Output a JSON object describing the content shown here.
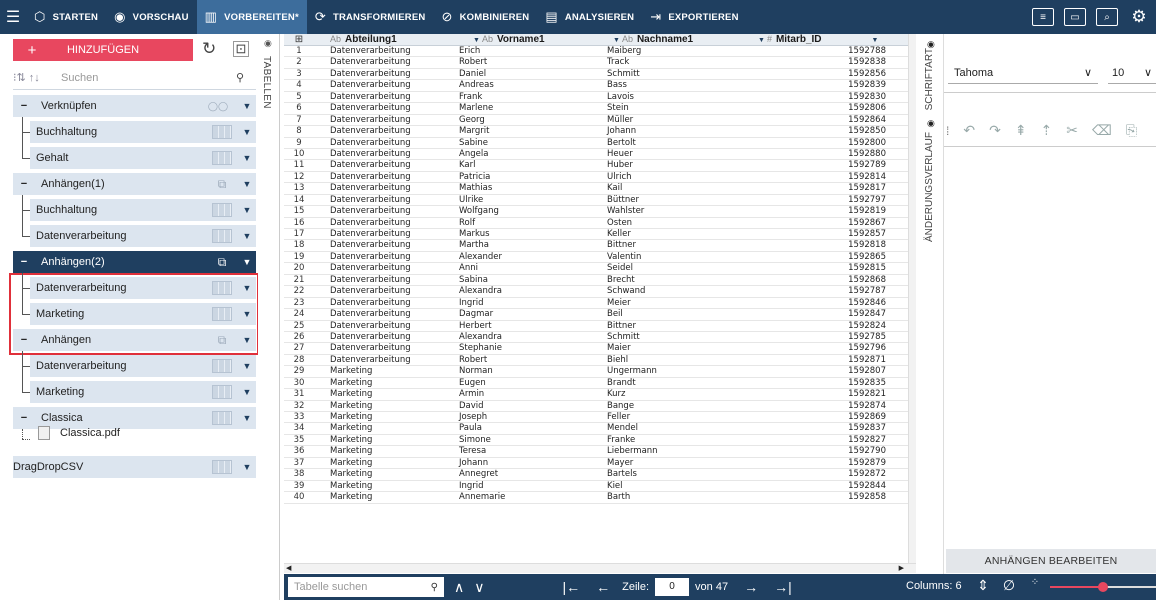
{
  "topbar": {
    "items": [
      {
        "label": "STARTEN",
        "icon": "cube-icon"
      },
      {
        "label": "VORSCHAU",
        "icon": "eye-icon"
      },
      {
        "label": "VORBEREITEN*",
        "icon": "table-icon",
        "active": true
      },
      {
        "label": "TRANSFORMIEREN",
        "icon": "transform-icon"
      },
      {
        "label": "KOMBINIEREN",
        "icon": "combine-icon"
      },
      {
        "label": "ANALYSIEREN",
        "icon": "analyze-icon"
      },
      {
        "label": "EXPORTIEREN",
        "icon": "export-icon"
      }
    ],
    "colors": {
      "bar": "#1f3f60",
      "active": "#3d6d9c"
    }
  },
  "left": {
    "add_label": "HINZUFÜGEN",
    "search_placeholder": "Suchen",
    "tree": [
      {
        "label": "Verknüpfen",
        "type": "group"
      },
      {
        "label": "Buchhaltung",
        "type": "child"
      },
      {
        "label": "Gehalt",
        "type": "child"
      },
      {
        "label": "Anhängen(1)",
        "type": "group"
      },
      {
        "label": "Buchhaltung",
        "type": "child"
      },
      {
        "label": "Datenverarbeitung",
        "type": "child"
      },
      {
        "label": "Anhängen(2)",
        "type": "group",
        "active": true
      },
      {
        "label": "Datenverarbeitung",
        "type": "child"
      },
      {
        "label": "Marketing",
        "type": "child"
      },
      {
        "label": "Anhängen",
        "type": "group"
      },
      {
        "label": "Datenverarbeitung",
        "type": "child"
      },
      {
        "label": "Marketing",
        "type": "child"
      },
      {
        "label": "Classica",
        "type": "group"
      },
      {
        "label": "DragDropCSV",
        "type": "root"
      }
    ],
    "pdf_file": "Classica.pdf"
  },
  "tables_tab_label": "TABELLEN",
  "grid": {
    "columns": [
      {
        "type": "Ab",
        "name": "Abteilung1"
      },
      {
        "type": "Ab",
        "name": "Vorname1"
      },
      {
        "type": "Ab",
        "name": "Nachname1"
      },
      {
        "type": "#",
        "name": "Mitarb_ID"
      }
    ],
    "rows": [
      [
        "1",
        "Datenverarbeitung",
        "Erich",
        "Maiberg",
        "1592788"
      ],
      [
        "2",
        "Datenverarbeitung",
        "Robert",
        "Track",
        "1592838"
      ],
      [
        "3",
        "Datenverarbeitung",
        "Daniel",
        "Schmitt",
        "1592856"
      ],
      [
        "4",
        "Datenverarbeitung",
        "Andreas",
        "Bass",
        "1592839"
      ],
      [
        "5",
        "Datenverarbeitung",
        "Frank",
        "Lavois",
        "1592830"
      ],
      [
        "6",
        "Datenverarbeitung",
        "Marlene",
        "Stein",
        "1592806"
      ],
      [
        "7",
        "Datenverarbeitung",
        "Georg",
        "Müller",
        "1592864"
      ],
      [
        "8",
        "Datenverarbeitung",
        "Margrit",
        "Johann",
        "1592850"
      ],
      [
        "9",
        "Datenverarbeitung",
        "Sabine",
        "Bertolt",
        "1592800"
      ],
      [
        "10",
        "Datenverarbeitung",
        "Angela",
        "Heuer",
        "1592880"
      ],
      [
        "11",
        "Datenverarbeitung",
        "Karl",
        "Huber",
        "1592789"
      ],
      [
        "12",
        "Datenverarbeitung",
        "Patricia",
        "Ulrich",
        "1592814"
      ],
      [
        "13",
        "Datenverarbeitung",
        "Mathias",
        "Kail",
        "1592817"
      ],
      [
        "14",
        "Datenverarbeitung",
        "Ulrike",
        "Büttner",
        "1592797"
      ],
      [
        "15",
        "Datenverarbeitung",
        "Wolfgang",
        "Wahlster",
        "1592819"
      ],
      [
        "16",
        "Datenverarbeitung",
        "Rolf",
        "Osten",
        "1592867"
      ],
      [
        "17",
        "Datenverarbeitung",
        "Markus",
        "Keller",
        "1592857"
      ],
      [
        "18",
        "Datenverarbeitung",
        "Martha",
        "Bittner",
        "1592818"
      ],
      [
        "19",
        "Datenverarbeitung",
        "Alexander",
        "Valentin",
        "1592865"
      ],
      [
        "20",
        "Datenverarbeitung",
        "Anni",
        "Seidel",
        "1592815"
      ],
      [
        "21",
        "Datenverarbeitung",
        "Sabina",
        "Brecht",
        "1592868"
      ],
      [
        "22",
        "Datenverarbeitung",
        "Alexandra",
        "Schwand",
        "1592787"
      ],
      [
        "23",
        "Datenverarbeitung",
        "Ingrid",
        "Meier",
        "1592846"
      ],
      [
        "24",
        "Datenverarbeitung",
        "Dagmar",
        "Beil",
        "1592847"
      ],
      [
        "25",
        "Datenverarbeitung",
        "Herbert",
        "Bittner",
        "1592824"
      ],
      [
        "26",
        "Datenverarbeitung",
        "Alexandra",
        "Schmitt",
        "1592785"
      ],
      [
        "27",
        "Datenverarbeitung",
        "Stephanie",
        "Maier",
        "1592796"
      ],
      [
        "28",
        "Datenverarbeitung",
        "Robert",
        "Biehl",
        "1592871"
      ],
      [
        "29",
        "Marketing",
        "Norman",
        "Ungermann",
        "1592807"
      ],
      [
        "30",
        "Marketing",
        "Eugen",
        "Brandt",
        "1592835"
      ],
      [
        "31",
        "Marketing",
        "Armin",
        "Kurz",
        "1592821"
      ],
      [
        "32",
        "Marketing",
        "David",
        "Bange",
        "1592874"
      ],
      [
        "33",
        "Marketing",
        "Joseph",
        "Feller",
        "1592869"
      ],
      [
        "34",
        "Marketing",
        "Paula",
        "Mendel",
        "1592837"
      ],
      [
        "35",
        "Marketing",
        "Simone",
        "Franke",
        "1592827"
      ],
      [
        "36",
        "Marketing",
        "Teresa",
        "Liebermann",
        "1592790"
      ],
      [
        "37",
        "Marketing",
        "Johann",
        "Mayer",
        "1592879"
      ],
      [
        "38",
        "Marketing",
        "Annegret",
        "Bartels",
        "1592872"
      ],
      [
        "39",
        "Marketing",
        "Ingrid",
        "Kiel",
        "1592844"
      ],
      [
        "40",
        "Marketing",
        "Annemarie",
        "Barth",
        "1592858"
      ]
    ]
  },
  "right": {
    "tab_font": "SCHRIFTART",
    "tab_history": "ÄNDERUNGSVERLAUF",
    "font_name": "Tahoma",
    "font_size": "10",
    "edit_button": "ANHÄNGEN BEARBEITEN"
  },
  "bottom": {
    "search_placeholder": "Tabelle suchen",
    "row_label": "Zeile:",
    "row_value": "0",
    "of_total": "von 47",
    "columns": "Columns: 6",
    "slider_value": 0.5,
    "accent": "#e8475f"
  }
}
